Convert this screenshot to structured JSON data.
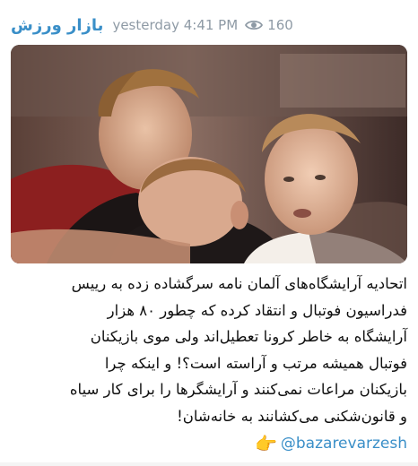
{
  "post": {
    "channel_name": "بازار ورزش",
    "timestamp": "yesterday 4:41 PM",
    "views": "160",
    "icons": {
      "views": "eye-icon",
      "signature": "pointing-hand-icon"
    },
    "caption_lines": [
      "اتحادیه آرایشگاه‌های آلمان نامه سرگشاده زده به رییس",
      "فدراسیون فوتبال و انتقاد کرده که چطور ۸۰ هزار",
      "آرایشگاه به خاطر کرونا تعطیل‌اند ولی موی بازیکنان",
      "فوتبال همیشه مرتب و آراسته است؟! و اینکه چرا",
      "بازیکنان مراعات نمی‌کنند و آرایشگرها را برای کار سیاه",
      "و قانون‌شکنی می‌کشانند به خانه‌شان!"
    ],
    "signature": {
      "hand_glyph": "👉",
      "handle": "@bazarevarzesh"
    }
  },
  "colors": {
    "accent": "#3a8fc8",
    "meta": "#8e9aa5",
    "text": "#111111"
  }
}
